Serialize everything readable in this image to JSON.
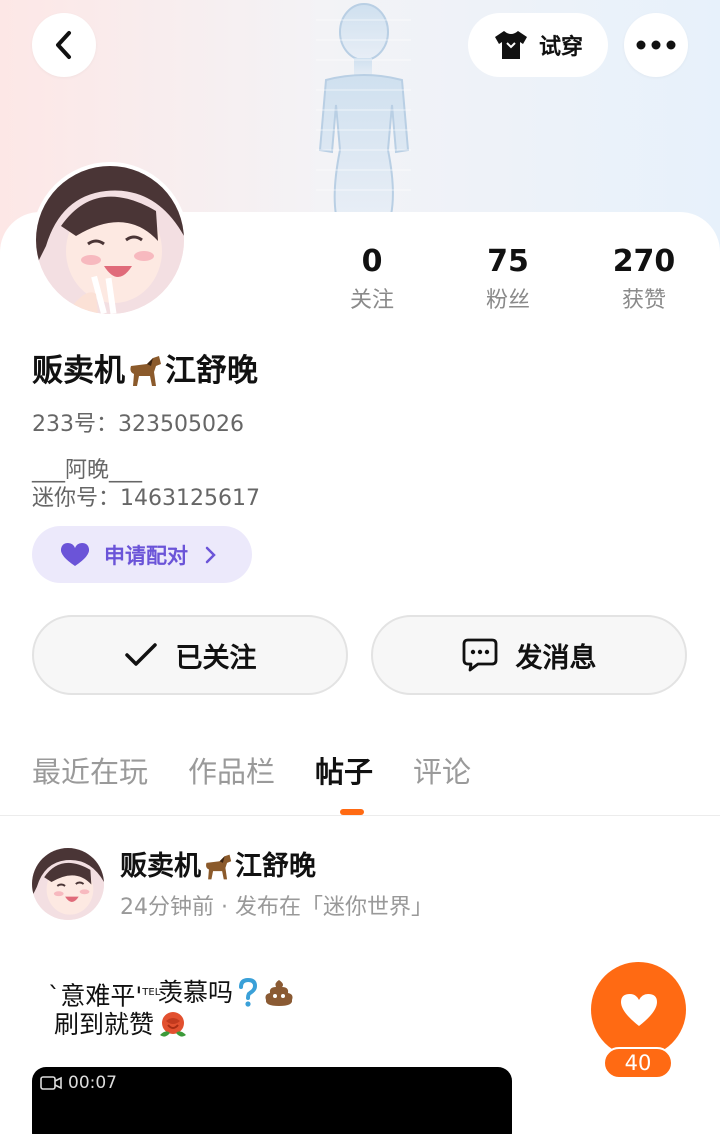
{
  "header": {
    "tryon_label": "试穿"
  },
  "profile": {
    "nickname_part1": "贩卖机",
    "nickname_part2": "江舒晚",
    "id_label": "233号：",
    "id_value": "323505026",
    "signature_line1": "___阿晚___",
    "signature_line2_label": "迷你号：",
    "signature_line2_value": "1463125617",
    "pair_button": "申请配对"
  },
  "stats": [
    {
      "value": "0",
      "label": "关注"
    },
    {
      "value": "75",
      "label": "粉丝"
    },
    {
      "value": "270",
      "label": "获赞"
    }
  ],
  "actions": {
    "follow_label": "已关注",
    "message_label": "发消息"
  },
  "tabs": [
    {
      "label": "最近在玩",
      "active": false
    },
    {
      "label": "作品栏",
      "active": false
    },
    {
      "label": "帖子",
      "active": true
    },
    {
      "label": "评论",
      "active": false
    }
  ],
  "post": {
    "author_part1": "贩卖机",
    "author_part2": "江舒晚",
    "meta": "24分钟前 · 发布在「迷你世界」",
    "line1": "`意难平'",
    "line1_suffix": "TEL",
    "line2": "羡慕吗",
    "line3": "刷到就赞",
    "video_duration": "00:07",
    "like_count": "40"
  },
  "colors": {
    "accent": "#ff6a13",
    "pair": "#6b54d8",
    "pair_bg": "#ece9fb"
  },
  "icons": [
    "back-arrow-icon",
    "tshirt-icon",
    "more-dots-icon",
    "horse-emoji-icon",
    "heart-icon",
    "chevron-right-icon",
    "check-icon",
    "chat-bubble-icon",
    "question-emoji-icon",
    "poop-emoji-icon",
    "rose-emoji-icon",
    "video-camera-icon",
    "like-heart-icon"
  ]
}
